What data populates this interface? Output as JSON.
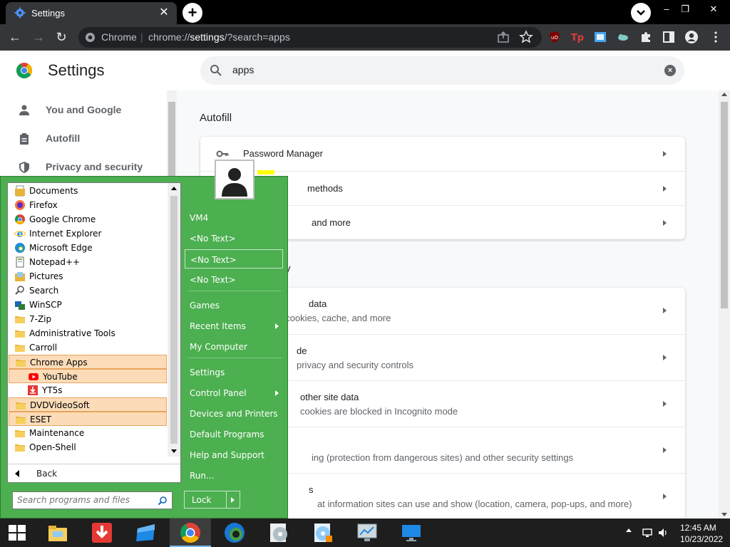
{
  "browser": {
    "tab_title": "Settings",
    "tab_close": "✕",
    "new_tab": "+",
    "origin_label": "Chrome",
    "url_separator": "|",
    "url_prefix": "chrome://",
    "url_host": "settings",
    "url_path": "/?search=apps",
    "window_controls": [
      "–",
      "❐",
      "✕"
    ]
  },
  "settings": {
    "title": "Settings",
    "search_value": "apps",
    "nav": [
      {
        "label": "You and Google",
        "icon": "person-icon"
      },
      {
        "label": "Autofill",
        "icon": "clipboard-icon"
      },
      {
        "label": "Privacy and security",
        "icon": "shield-icon"
      }
    ],
    "autofill_section": "Autofill",
    "autofill_rows": [
      {
        "label": "Password Manager",
        "icon": "key-icon"
      },
      {
        "label": "methods",
        "icon": "card-icon"
      },
      {
        "label": "and more",
        "icon": "pin-icon"
      }
    ],
    "privacy_fragment": "y",
    "privacy_rows": [
      {
        "label": "data",
        "sub": ", cookies, cache, and more"
      },
      {
        "label": "de",
        "sub": "privacy and security controls"
      },
      {
        "label": "other site data",
        "sub": "cookies are blocked in Incognito mode"
      },
      {
        "label": "",
        "sub": "ing (protection from dangerous sites) and other security settings"
      },
      {
        "label": "s",
        "sub": "at information sites can use and show (location, camera, pop-ups, and more)"
      }
    ]
  },
  "start_menu": {
    "programs": [
      {
        "label": "Documents",
        "icon": "folder-docs-icon"
      },
      {
        "label": "Firefox",
        "icon": "firefox-icon"
      },
      {
        "label": "Google Chrome",
        "icon": "chrome-icon"
      },
      {
        "label": "Internet Explorer",
        "icon": "ie-icon"
      },
      {
        "label": "Microsoft Edge",
        "icon": "edge-icon"
      },
      {
        "label": "Notepad++",
        "icon": "notepadpp-icon"
      },
      {
        "label": "Pictures",
        "icon": "folder-pictures-icon"
      },
      {
        "label": "Search",
        "icon": "search-icon"
      },
      {
        "label": "WinSCP",
        "icon": "winscp-icon"
      },
      {
        "label": "7-Zip",
        "icon": "folder-icon"
      },
      {
        "label": "Administrative Tools",
        "icon": "folder-icon"
      },
      {
        "label": "Carroll",
        "icon": "folder-icon"
      },
      {
        "label": "Chrome Apps",
        "icon": "folder-icon"
      },
      {
        "label": "YouTube",
        "icon": "youtube-icon"
      },
      {
        "label": "YT5s",
        "icon": "download-icon"
      },
      {
        "label": "DVDVideoSoft",
        "icon": "folder-icon"
      },
      {
        "label": "ESET",
        "icon": "folder-icon"
      },
      {
        "label": "Maintenance",
        "icon": "folder-icon"
      },
      {
        "label": "Open-Shell",
        "icon": "folder-icon"
      }
    ],
    "back_label": "Back",
    "search_placeholder": "Search programs and files",
    "right_items": [
      {
        "label": "VM4"
      },
      {
        "label": "<No Text>"
      },
      {
        "label": "<No Text>"
      },
      {
        "label": "<No Text>"
      },
      {
        "label": "Games"
      },
      {
        "label": "Recent Items"
      },
      {
        "label": "My Computer"
      },
      {
        "label": "Settings"
      },
      {
        "label": "Control Panel"
      },
      {
        "label": "Devices and Printers"
      },
      {
        "label": "Default Programs"
      },
      {
        "label": "Help and Support"
      },
      {
        "label": "Run..."
      }
    ],
    "lock_label": "Lock"
  },
  "taskbar": {
    "apps": [
      "file-explorer-icon",
      "download-app-icon",
      "blue-app-icon",
      "chrome-icon",
      "edge-icon",
      "disc-image-icon",
      "disc-settings-icon",
      "monitor-chart-icon",
      "desktop-icon"
    ],
    "time": "12:45 AM",
    "date": "10/23/2022"
  },
  "colors": {
    "start_menu_green": "#4caf50",
    "highlight": "#fcdcb8",
    "chrome_dark": "#35363a"
  }
}
